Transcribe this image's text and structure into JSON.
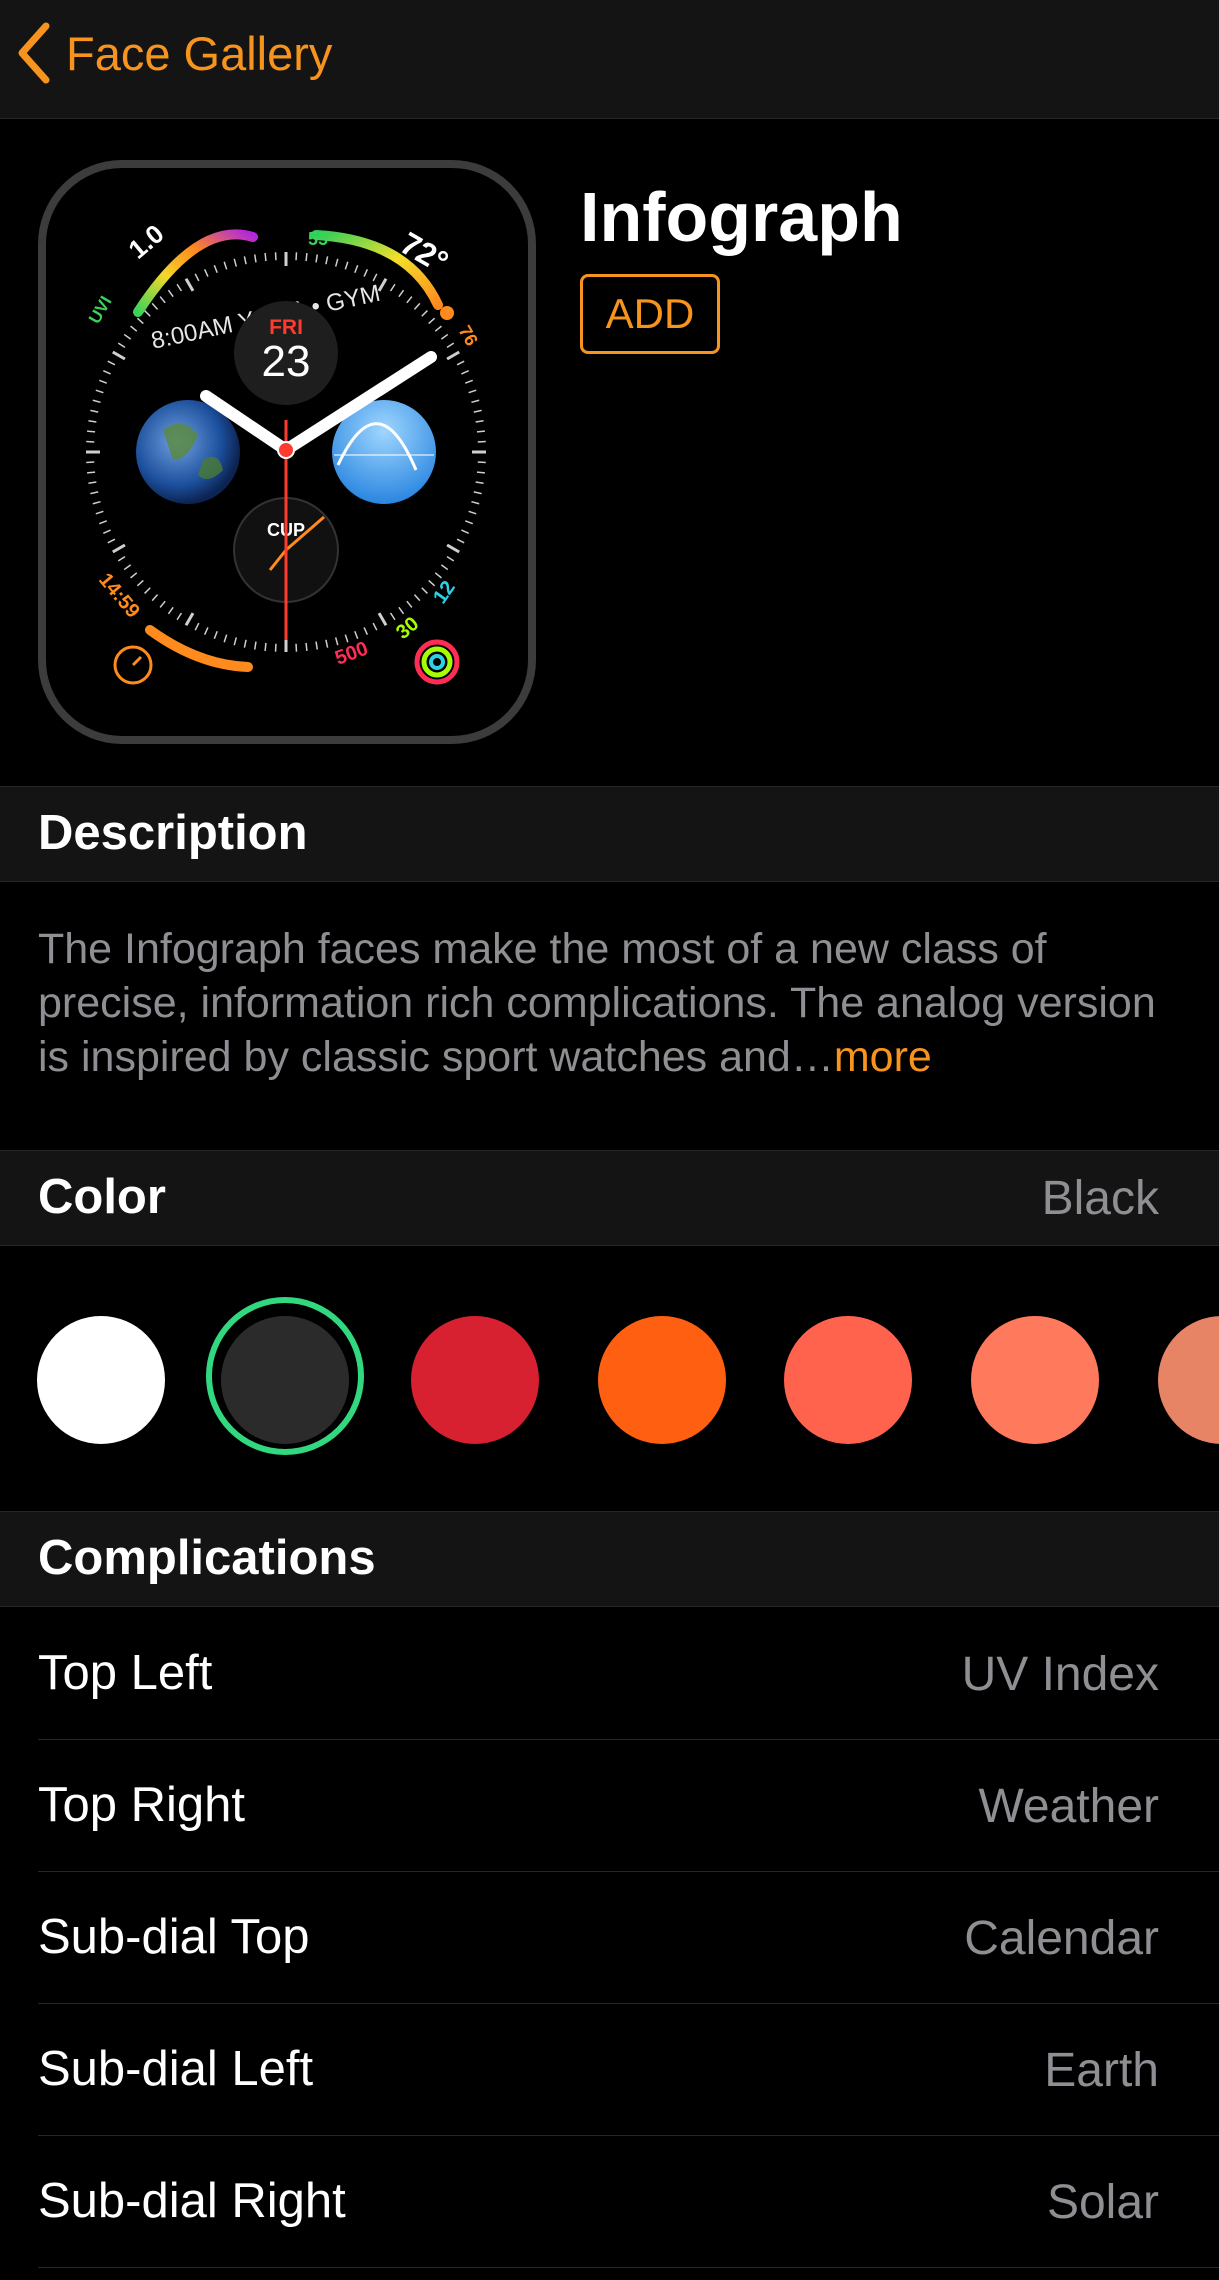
{
  "nav": {
    "back_label": "Face Gallery"
  },
  "face": {
    "name": "Infograph",
    "add_label": "ADD",
    "preview": {
      "uv_label": "UVI",
      "uv_value": "1.0",
      "calendar_text": "8:00AM YOGA • GYM",
      "temp_low": "55",
      "temp": "72°",
      "temp_high": "76",
      "date_day": "FRI",
      "date_num": "23",
      "chrono_label": "CUP",
      "timer_text": "14:59",
      "activity_move": "500",
      "activity_exercise": "30",
      "activity_stand": "12"
    }
  },
  "description": {
    "title": "Description",
    "text": "The Infograph faces make the most of a new class of precise, information rich complications. The analog version is inspired by classic sport watches and…",
    "more_label": "more"
  },
  "color": {
    "title": "Color",
    "selected": "Black",
    "swatches": [
      "#ffffff",
      "#2b2b2b",
      "#d72030",
      "#ff5f10",
      "#ff634d",
      "#ff7a5c",
      "#e88466"
    ]
  },
  "complications": {
    "title": "Complications",
    "rows": [
      {
        "label": "Top Left",
        "value": "UV Index"
      },
      {
        "label": "Top Right",
        "value": "Weather"
      },
      {
        "label": "Sub-dial Top",
        "value": "Calendar"
      },
      {
        "label": "Sub-dial Left",
        "value": "Earth"
      },
      {
        "label": "Sub-dial Right",
        "value": "Solar"
      }
    ]
  }
}
